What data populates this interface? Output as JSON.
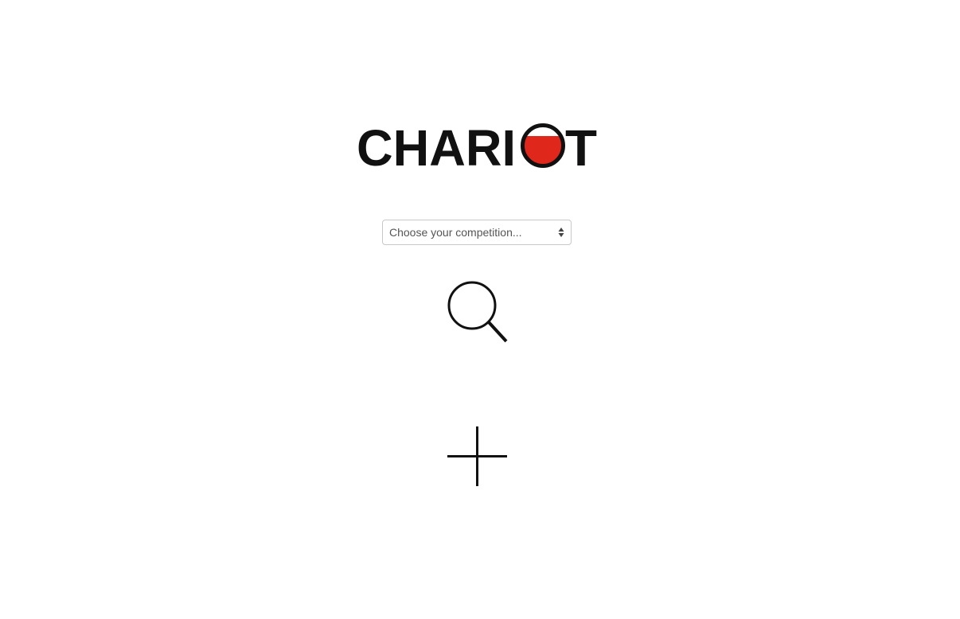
{
  "logo": {
    "text_left": "CHARI",
    "text_right": "T",
    "accent_color": "#e0271c"
  },
  "competition_select": {
    "placeholder": "Choose your competition..."
  },
  "icons": {
    "search": "search-icon",
    "add": "plus-icon",
    "select_arrows": "sort-arrows-icon"
  }
}
